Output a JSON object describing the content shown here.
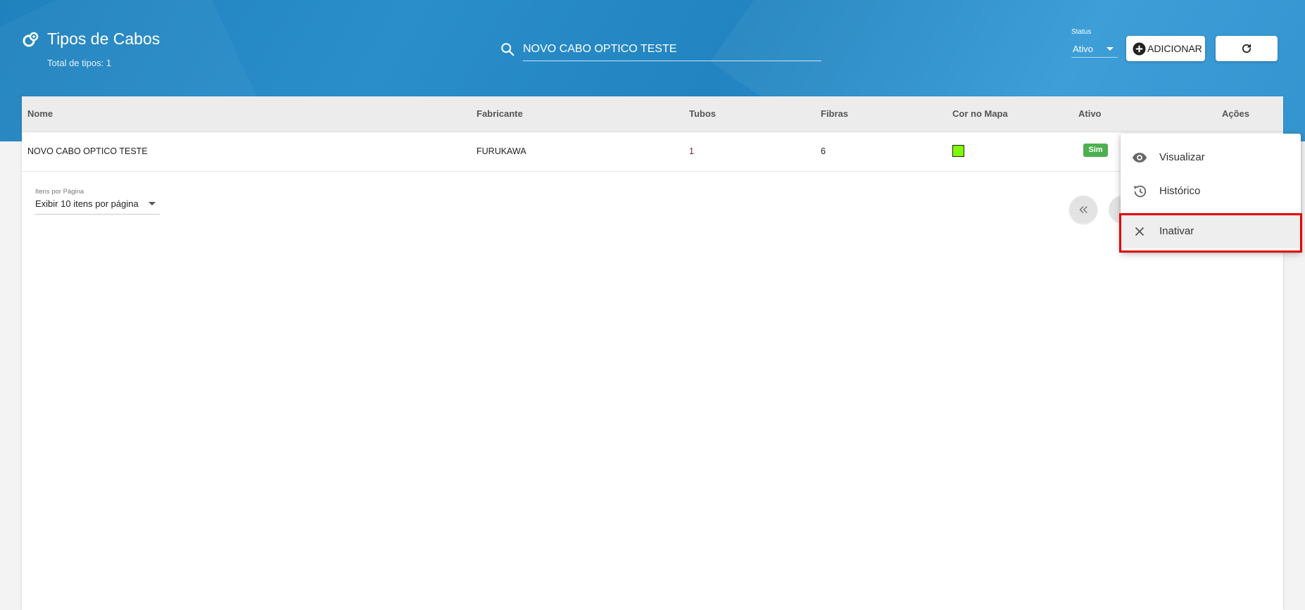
{
  "header": {
    "title": "Tipos de Cabos",
    "subtitle": "Total de tipos: 1",
    "title_icon": "cable-type-icon"
  },
  "search": {
    "value": "NOVO CABO OPTICO TESTE",
    "icon": "search-icon"
  },
  "status_filter": {
    "label": "Status",
    "value": "Ativo"
  },
  "toolbar": {
    "add_label": "ADICIONAR",
    "refresh_icon": "refresh-icon"
  },
  "table": {
    "columns": [
      "Nome",
      "Fabricante",
      "Tubos",
      "Fibras",
      "Cor no Mapa",
      "Ativo",
      "Ações"
    ],
    "rows": [
      {
        "nome": "NOVO CABO OPTICO TESTE",
        "fabricante": "FURUKAWA",
        "tubos": "1",
        "fibras": "6",
        "cor_no_mapa": "#7dfc00",
        "ativo": "Sim"
      }
    ]
  },
  "pagination": {
    "items_per_page_label": "Itens por Página",
    "items_per_page_value": "Exibir 10 itens por página"
  },
  "actions_menu": {
    "items": [
      {
        "label": "Visualizar",
        "icon": "eye-icon"
      },
      {
        "label": "Histórico",
        "icon": "history-icon"
      },
      {
        "label": "Inativar",
        "icon": "close-icon",
        "highlighted": true
      }
    ]
  },
  "colors": {
    "header_blue": "#2284c0",
    "badge_green": "#4caf50",
    "highlight_red": "#e00000"
  }
}
